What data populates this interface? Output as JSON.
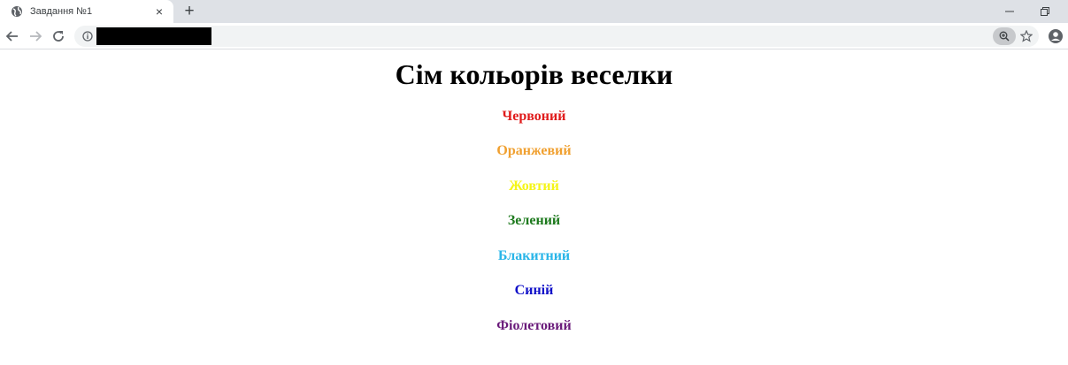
{
  "browser": {
    "tab_title": "Завдання №1",
    "tab_close": "×",
    "new_tab": "+",
    "minimize": "–",
    "restore": "❐",
    "icons": [
      "globe-icon",
      "back-icon",
      "forward-icon",
      "reload-icon",
      "info-icon",
      "zoom-icon",
      "star-icon",
      "profile-icon"
    ]
  },
  "page": {
    "title": "Сім кольорів веселки",
    "colors": [
      {
        "label": "Червоний",
        "color": "#e01b1b"
      },
      {
        "label": "Оранжевий",
        "color": "#f0a030"
      },
      {
        "label": "Жовтий",
        "color": "#f5f518"
      },
      {
        "label": "Зелений",
        "color": "#1e7a1e"
      },
      {
        "label": "Блакитний",
        "color": "#29b5e8"
      },
      {
        "label": "Синій",
        "color": "#1010c8"
      },
      {
        "label": "Фіолетовий",
        "color": "#6a1a7a"
      }
    ]
  }
}
